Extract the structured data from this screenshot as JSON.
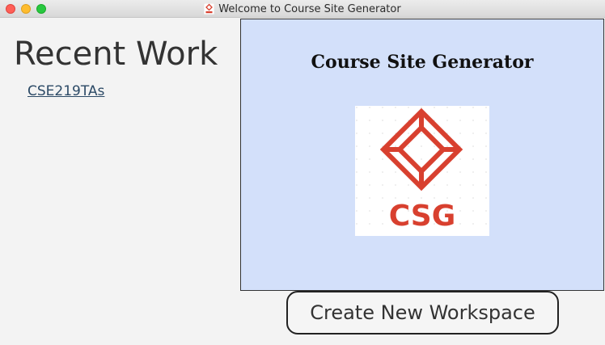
{
  "window": {
    "title": "Welcome to Course Site Generator"
  },
  "recent": {
    "heading": "Recent Work",
    "items": [
      {
        "label": "CSE219TAs"
      }
    ]
  },
  "splash": {
    "title": "Course Site Generator",
    "logo_text": "CSG",
    "logo_color": "#d8402f",
    "background_color": "#d3e0fa"
  },
  "actions": {
    "create_label": "Create New Workspace"
  },
  "icons": {
    "app_icon": "csg-app-icon",
    "logo": "csg-logo-icon"
  }
}
